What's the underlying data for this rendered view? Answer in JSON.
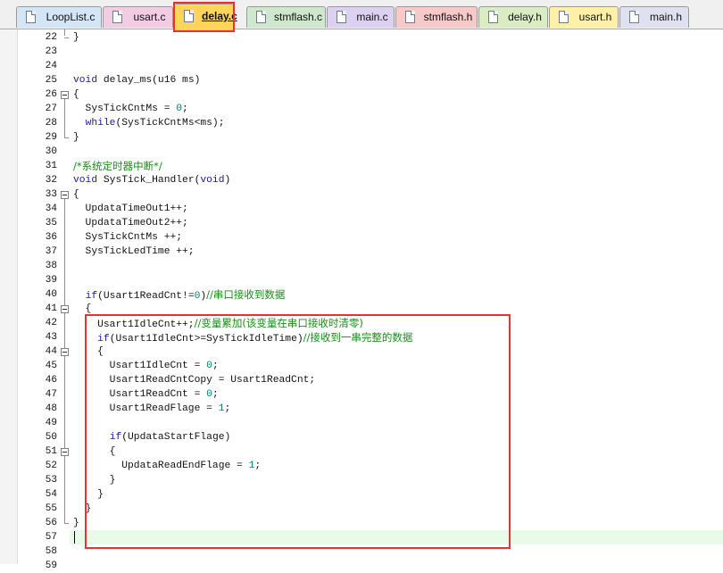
{
  "tabs": [
    {
      "label": "LoopList.c",
      "color": "#d4e5f5",
      "active": false
    },
    {
      "label": "usart.c",
      "color": "#f2cce2",
      "active": false
    },
    {
      "label": "delay.c",
      "color": "#ffd45a",
      "active": true
    },
    {
      "label": "stmflash.c",
      "color": "#cfe8cd",
      "active": false
    },
    {
      "label": "main.c",
      "color": "#dcd1f0",
      "active": false
    },
    {
      "label": "stmflash.h",
      "color": "#f7c9c9",
      "active": false
    },
    {
      "label": "delay.h",
      "color": "#d9ecc4",
      "active": false
    },
    {
      "label": "usart.h",
      "color": "#fff0a8",
      "active": false
    },
    {
      "label": "main.h",
      "color": "#dfe1f1",
      "active": false
    }
  ],
  "editor": {
    "lines": [
      {
        "num": "22",
        "tokens": [
          {
            "t": "}",
            "c": ""
          }
        ]
      },
      {
        "num": "23",
        "tokens": []
      },
      {
        "num": "24",
        "tokens": []
      },
      {
        "num": "25",
        "tokens": [
          {
            "t": "void",
            "c": "kw"
          },
          {
            "t": " delay_ms(u16 ms)",
            "c": ""
          }
        ]
      },
      {
        "num": "26",
        "tokens": [
          {
            "t": "{",
            "c": ""
          }
        ]
      },
      {
        "num": "27",
        "tokens": [
          {
            "t": "  SysTickCntMs = ",
            "c": ""
          },
          {
            "t": "0",
            "c": "num"
          },
          {
            "t": ";",
            "c": ""
          }
        ]
      },
      {
        "num": "28",
        "tokens": [
          {
            "t": "  ",
            "c": ""
          },
          {
            "t": "while",
            "c": "kw"
          },
          {
            "t": "(SysTickCntMs<ms);",
            "c": ""
          }
        ]
      },
      {
        "num": "29",
        "tokens": [
          {
            "t": "}",
            "c": ""
          }
        ]
      },
      {
        "num": "30",
        "tokens": []
      },
      {
        "num": "31",
        "tokens": [
          {
            "t": "/*系统定时器中断*/",
            "c": "cm"
          }
        ]
      },
      {
        "num": "32",
        "tokens": [
          {
            "t": "void",
            "c": "kw"
          },
          {
            "t": " SysTick_Handler(",
            "c": ""
          },
          {
            "t": "void",
            "c": "kw"
          },
          {
            "t": ")",
            "c": ""
          }
        ]
      },
      {
        "num": "33",
        "tokens": [
          {
            "t": "{",
            "c": ""
          }
        ]
      },
      {
        "num": "34",
        "tokens": [
          {
            "t": "  UpdataTimeOut1++;",
            "c": ""
          }
        ]
      },
      {
        "num": "35",
        "tokens": [
          {
            "t": "  UpdataTimeOut2++;",
            "c": ""
          }
        ]
      },
      {
        "num": "36",
        "tokens": [
          {
            "t": "  SysTickCntMs ++;",
            "c": ""
          }
        ]
      },
      {
        "num": "37",
        "tokens": [
          {
            "t": "  SysTickLedTime ++;",
            "c": ""
          }
        ]
      },
      {
        "num": "38",
        "tokens": []
      },
      {
        "num": "39",
        "tokens": []
      },
      {
        "num": "40",
        "tokens": [
          {
            "t": "  ",
            "c": ""
          },
          {
            "t": "if",
            "c": "kw"
          },
          {
            "t": "(Usart1ReadCnt!=",
            "c": ""
          },
          {
            "t": "0",
            "c": "num"
          },
          {
            "t": ")",
            "c": ""
          },
          {
            "t": "//串口接收到数据",
            "c": "cm"
          }
        ]
      },
      {
        "num": "41",
        "tokens": [
          {
            "t": "  {",
            "c": ""
          }
        ]
      },
      {
        "num": "42",
        "tokens": [
          {
            "t": "    Usart1IdleCnt++;",
            "c": ""
          },
          {
            "t": "//变量累加(该变量在串口接收时清零)",
            "c": "cm"
          }
        ]
      },
      {
        "num": "43",
        "tokens": [
          {
            "t": "    ",
            "c": ""
          },
          {
            "t": "if",
            "c": "kw"
          },
          {
            "t": "(Usart1IdleCnt>=SysTickIdleTime)",
            "c": ""
          },
          {
            "t": "//接收到一串完整的数据",
            "c": "cm"
          }
        ]
      },
      {
        "num": "44",
        "tokens": [
          {
            "t": "    {",
            "c": ""
          }
        ]
      },
      {
        "num": "45",
        "tokens": [
          {
            "t": "      Usart1IdleCnt = ",
            "c": ""
          },
          {
            "t": "0",
            "c": "num"
          },
          {
            "t": ";",
            "c": ""
          }
        ]
      },
      {
        "num": "46",
        "tokens": [
          {
            "t": "      Usart1ReadCntCopy = Usart1ReadCnt;",
            "c": ""
          }
        ]
      },
      {
        "num": "47",
        "tokens": [
          {
            "t": "      Usart1ReadCnt = ",
            "c": ""
          },
          {
            "t": "0",
            "c": "num"
          },
          {
            "t": ";",
            "c": ""
          }
        ]
      },
      {
        "num": "48",
        "tokens": [
          {
            "t": "      Usart1ReadFlage = ",
            "c": ""
          },
          {
            "t": "1",
            "c": "num"
          },
          {
            "t": ";",
            "c": ""
          }
        ]
      },
      {
        "num": "49",
        "tokens": []
      },
      {
        "num": "50",
        "tokens": [
          {
            "t": "      ",
            "c": ""
          },
          {
            "t": "if",
            "c": "kw"
          },
          {
            "t": "(UpdataStartFlage)",
            "c": ""
          }
        ]
      },
      {
        "num": "51",
        "tokens": [
          {
            "t": "      {",
            "c": ""
          }
        ]
      },
      {
        "num": "52",
        "tokens": [
          {
            "t": "        UpdataReadEndFlage = ",
            "c": ""
          },
          {
            "t": "1",
            "c": "num"
          },
          {
            "t": ";",
            "c": ""
          }
        ]
      },
      {
        "num": "53",
        "tokens": [
          {
            "t": "      }",
            "c": ""
          }
        ]
      },
      {
        "num": "54",
        "tokens": [
          {
            "t": "    }",
            "c": ""
          }
        ]
      },
      {
        "num": "55",
        "tokens": [
          {
            "t": "  }",
            "c": ""
          }
        ]
      },
      {
        "num": "56",
        "tokens": [
          {
            "t": "}",
            "c": ""
          }
        ]
      },
      {
        "num": "57",
        "tokens": []
      },
      {
        "num": "58",
        "tokens": []
      },
      {
        "num": "59",
        "tokens": []
      }
    ]
  }
}
